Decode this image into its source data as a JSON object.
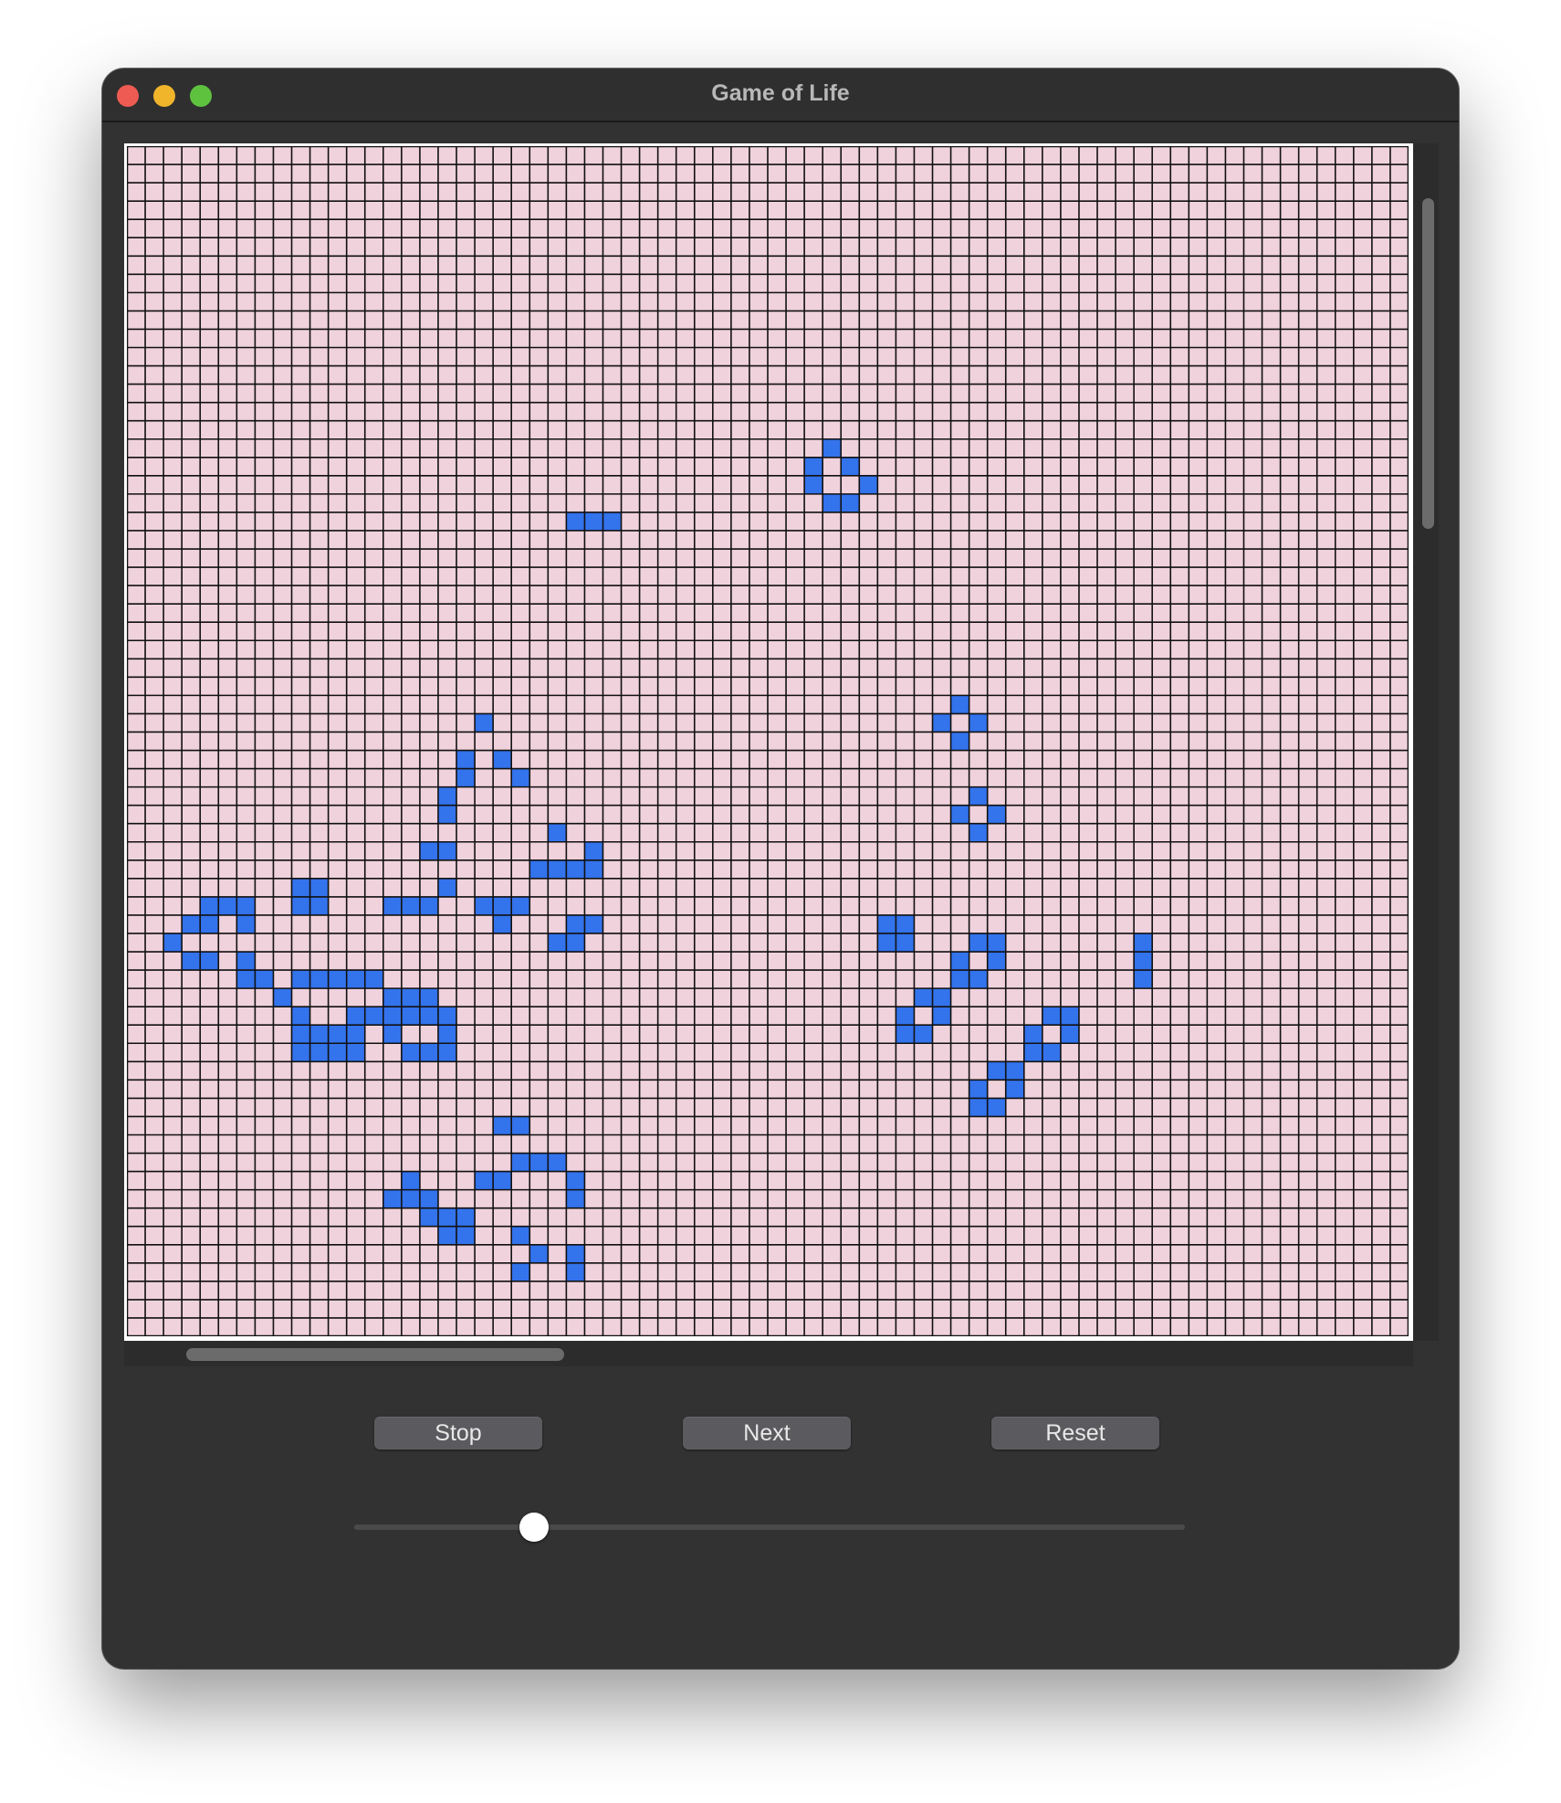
{
  "window": {
    "title": "Game of Life"
  },
  "controls": {
    "stop_label": "Stop",
    "next_label": "Next",
    "reset_label": "Reset",
    "speed_slider": {
      "value": 0.22,
      "min": 0,
      "max": 1
    }
  },
  "grid": {
    "columns": 70,
    "rows": 65,
    "dead_color": "#f0d2dc",
    "alive_color": "#3373ec",
    "line_color": "#111111",
    "live_cells": [
      [
        38,
        16
      ],
      [
        37,
        17
      ],
      [
        39,
        17
      ],
      [
        37,
        18
      ],
      [
        40,
        18
      ],
      [
        38,
        19
      ],
      [
        39,
        19
      ],
      [
        24,
        20
      ],
      [
        25,
        20
      ],
      [
        26,
        20
      ],
      [
        45,
        30
      ],
      [
        44,
        31
      ],
      [
        46,
        31
      ],
      [
        45,
        32
      ],
      [
        19,
        31
      ],
      [
        18,
        33
      ],
      [
        20,
        33
      ],
      [
        18,
        34
      ],
      [
        21,
        34
      ],
      [
        17,
        35
      ],
      [
        17,
        36
      ],
      [
        46,
        35
      ],
      [
        45,
        36
      ],
      [
        47,
        36
      ],
      [
        46,
        37
      ],
      [
        23,
        37
      ],
      [
        16,
        38
      ],
      [
        17,
        38
      ],
      [
        25,
        38
      ],
      [
        22,
        39
      ],
      [
        23,
        39
      ],
      [
        24,
        39
      ],
      [
        25,
        39
      ],
      [
        10,
        40
      ],
      [
        10,
        41
      ],
      [
        9,
        40
      ],
      [
        9,
        41
      ],
      [
        17,
        40
      ],
      [
        16,
        41
      ],
      [
        15,
        41
      ],
      [
        14,
        41
      ],
      [
        21,
        41
      ],
      [
        20,
        41
      ],
      [
        19,
        41
      ],
      [
        20,
        42
      ],
      [
        24,
        42
      ],
      [
        25,
        42
      ],
      [
        24,
        43
      ],
      [
        23,
        43
      ],
      [
        4,
        41
      ],
      [
        5,
        41
      ],
      [
        6,
        41
      ],
      [
        3,
        42
      ],
      [
        4,
        42
      ],
      [
        6,
        42
      ],
      [
        2,
        43
      ],
      [
        3,
        44
      ],
      [
        4,
        44
      ],
      [
        6,
        44
      ],
      [
        6,
        45
      ],
      [
        7,
        45
      ],
      [
        9,
        45
      ],
      [
        10,
        45
      ],
      [
        11,
        45
      ],
      [
        12,
        45
      ],
      [
        13,
        45
      ],
      [
        8,
        46
      ],
      [
        9,
        47
      ],
      [
        12,
        47
      ],
      [
        13,
        47
      ],
      [
        10,
        48
      ],
      [
        11,
        48
      ],
      [
        12,
        48
      ],
      [
        10,
        49
      ],
      [
        11,
        49
      ],
      [
        12,
        49
      ],
      [
        14,
        46
      ],
      [
        15,
        46
      ],
      [
        16,
        46
      ],
      [
        15,
        47
      ],
      [
        16,
        47
      ],
      [
        17,
        47
      ],
      [
        9,
        48
      ],
      [
        10,
        48
      ],
      [
        9,
        49
      ],
      [
        10,
        49
      ],
      [
        41,
        42
      ],
      [
        42,
        42
      ],
      [
        41,
        43
      ],
      [
        42,
        43
      ],
      [
        46,
        43
      ],
      [
        47,
        43
      ],
      [
        45,
        44
      ],
      [
        47,
        44
      ],
      [
        45,
        45
      ],
      [
        46,
        45
      ],
      [
        55,
        43
      ],
      [
        55,
        44
      ],
      [
        55,
        45
      ],
      [
        43,
        46
      ],
      [
        44,
        46
      ],
      [
        42,
        47
      ],
      [
        44,
        47
      ],
      [
        42,
        48
      ],
      [
        43,
        48
      ],
      [
        50,
        47
      ],
      [
        51,
        47
      ],
      [
        49,
        48
      ],
      [
        51,
        48
      ],
      [
        49,
        49
      ],
      [
        50,
        49
      ],
      [
        14,
        47
      ],
      [
        15,
        47
      ],
      [
        14,
        48
      ],
      [
        17,
        48
      ],
      [
        15,
        49
      ],
      [
        16,
        49
      ],
      [
        17,
        49
      ],
      [
        47,
        50
      ],
      [
        48,
        50
      ],
      [
        46,
        51
      ],
      [
        48,
        51
      ],
      [
        46,
        52
      ],
      [
        47,
        52
      ],
      [
        20,
        53
      ],
      [
        21,
        53
      ],
      [
        21,
        55
      ],
      [
        22,
        55
      ],
      [
        23,
        55
      ],
      [
        15,
        56
      ],
      [
        20,
        56
      ],
      [
        19,
        56
      ],
      [
        24,
        56
      ],
      [
        24,
        57
      ],
      [
        16,
        57
      ],
      [
        14,
        57
      ],
      [
        15,
        57
      ],
      [
        16,
        58
      ],
      [
        17,
        58
      ],
      [
        18,
        58
      ],
      [
        17,
        59
      ],
      [
        18,
        59
      ],
      [
        21,
        59
      ],
      [
        22,
        60
      ],
      [
        24,
        60
      ],
      [
        21,
        61
      ],
      [
        24,
        61
      ]
    ]
  }
}
